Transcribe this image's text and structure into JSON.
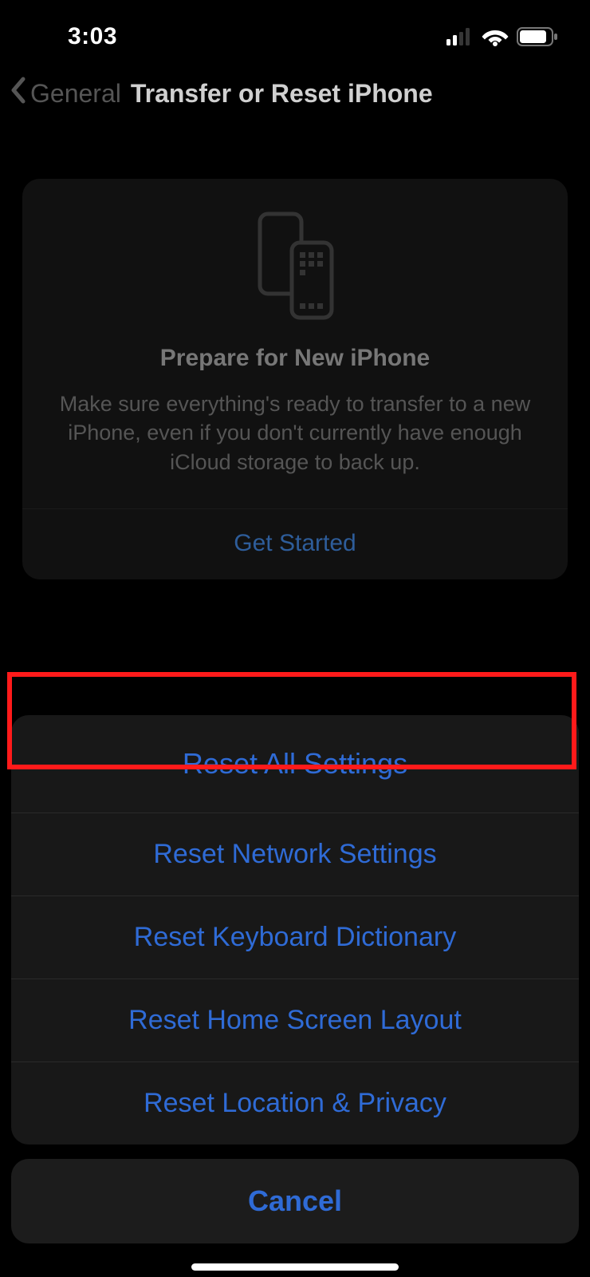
{
  "status": {
    "time": "3:03"
  },
  "nav": {
    "back_label": "General",
    "title": "Transfer or Reset iPhone"
  },
  "prepare_card": {
    "title": "Prepare for New iPhone",
    "description": "Make sure everything's ready to transfer to a new iPhone, even if you don't currently have enough iCloud storage to back up.",
    "cta": "Get Started"
  },
  "action_sheet": {
    "items": [
      "Reset All Settings",
      "Reset Network Settings",
      "Reset Keyboard Dictionary",
      "Reset Home Screen Layout",
      "Reset Location & Privacy"
    ],
    "cancel": "Cancel"
  }
}
